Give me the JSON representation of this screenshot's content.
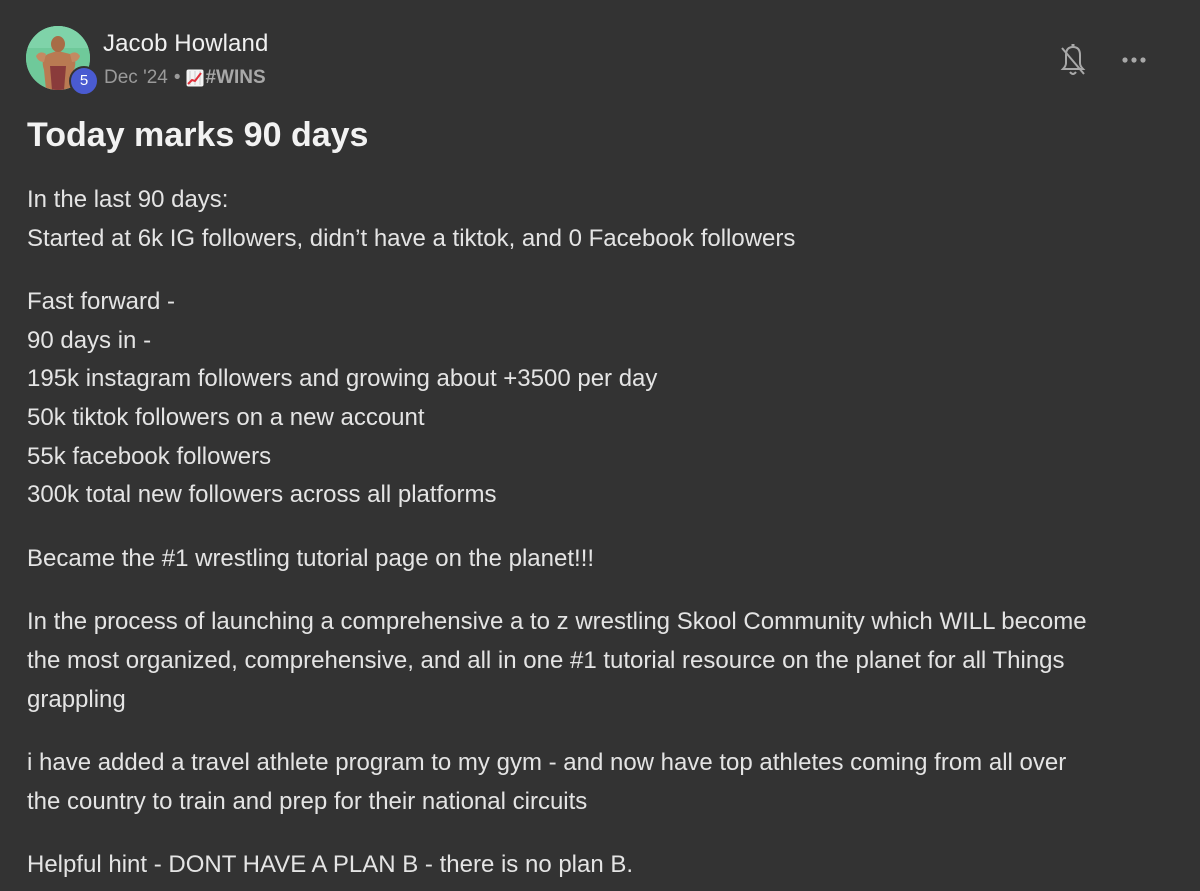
{
  "post": {
    "author": "Jacob Howland",
    "level": "5",
    "date": "Dec '24",
    "separator": "•",
    "category_icon": "chart-increasing-icon",
    "category": "#WINS",
    "title": "Today marks 90 days",
    "paragraphs": [
      [
        "In the last 90 days:",
        "Started at 6k IG followers, didn’t have a tiktok, and 0 Facebook followers"
      ],
      [
        "Fast forward -",
        "90 days in -",
        "195k instagram followers and growing about +3500 per day",
        "50k tiktok followers on a new account",
        "55k facebook followers",
        "300k total new followers across all platforms"
      ],
      [
        "Became the #1 wrestling tutorial page on the planet!!!"
      ],
      [
        "In the process of launching a comprehensive a to z wrestling Skool Community which WILL become",
        "the most organized, comprehensive, and all in one #1 tutorial resource on the planet for all Things",
        "grappling"
      ],
      [
        "i have added a travel athlete program to my gym - and now have top athletes coming from all over",
        "the country to train and prep for their national circuits"
      ],
      [
        "Helpful hint - DONT HAVE A PLAN B - there is no plan B."
      ]
    ]
  },
  "icons": {
    "bell": "bell-off-icon",
    "more": "more-options-icon",
    "avatar": "avatar"
  },
  "colors": {
    "background": "#333333",
    "level_badge": "#4a5bd1",
    "avatar_bg": "#6fc99a",
    "meta_text": "#9a9a9a"
  }
}
